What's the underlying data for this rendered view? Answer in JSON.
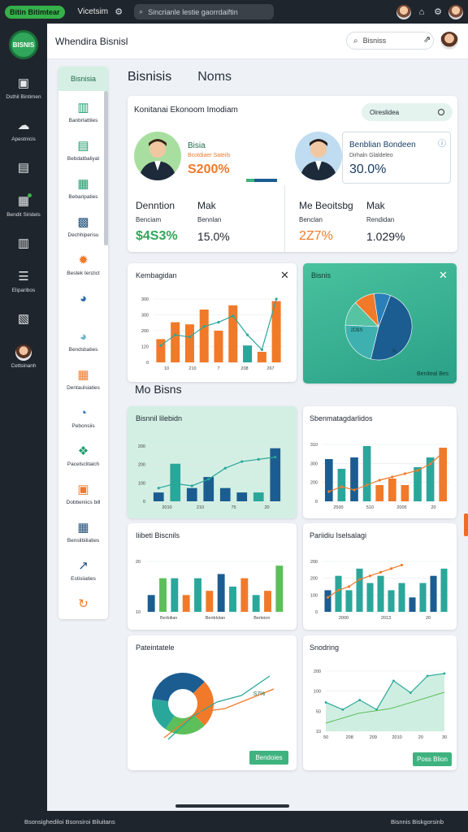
{
  "topbar": {
    "app_name": "Bitin Bitimtear",
    "label": "Vicetsim",
    "search_placeholder": "Sincrianle lestie gaorrdaiftin",
    "icons": [
      "search-icon",
      "home-icon",
      "gear-icon"
    ]
  },
  "sidebar": {
    "logo_text": "BISNIS",
    "items": [
      {
        "label": "Dsthil Bintimen",
        "icon": "dashboard-icon"
      },
      {
        "label": "Apestnicis",
        "icon": "cloud-icon"
      },
      {
        "label": "",
        "icon": "folder-icon"
      },
      {
        "label": "Bendit Siridels",
        "icon": "document-icon",
        "badge": true
      },
      {
        "label": "",
        "icon": "grid-icon"
      },
      {
        "label": "Eliparibos",
        "icon": "chat-icon"
      },
      {
        "label": "",
        "icon": "report-icon"
      },
      {
        "label": "Cettsinanh",
        "icon": "user-icon"
      }
    ]
  },
  "header": {
    "title": "Whendira Bisnisl",
    "search_label": "Bisniss"
  },
  "subnav": {
    "header": "Bisnisia",
    "items": [
      {
        "label": "Banbrlattiles",
        "icon": "chart-icon",
        "color": "#1e9b6e"
      },
      {
        "label": "Bebdatbaliyat",
        "icon": "monitor-icon",
        "color": "#1e9b6e"
      },
      {
        "label": "Bebaripaties",
        "icon": "table-icon",
        "color": "#1e9b6e"
      },
      {
        "label": "Dechhiperisu",
        "icon": "database-icon",
        "color": "#1f4f7a"
      },
      {
        "label": "Bestek tenzict",
        "icon": "gear-icon",
        "color": "#f07a2a"
      },
      {
        "label": "",
        "icon": "pie-icon",
        "color": "#2a6bb0"
      },
      {
        "label": "Bendsbaties",
        "icon": "pie-icon",
        "color": "#6fb0c9"
      },
      {
        "label": "Dentaulsiaties",
        "icon": "calendar-icon",
        "color": "#f07a2a"
      },
      {
        "label": "Pebonsiis",
        "icon": "donut-icon",
        "color": "#2a6bb0"
      },
      {
        "label": "Pacelsclitaich",
        "icon": "nodes-icon",
        "color": "#1e9b6e"
      },
      {
        "label": "Dobbeniics bill",
        "icon": "briefcase-icon",
        "color": "#f07a2a"
      },
      {
        "label": "Benslibiliaties",
        "icon": "calculator-icon",
        "color": "#1f4f7a"
      },
      {
        "label": "Estisiiaties",
        "icon": "trend-icon",
        "color": "#1f4f7a"
      },
      {
        "label": "",
        "icon": "refresh-icon",
        "color": "#f07a2a"
      }
    ]
  },
  "tabs": [
    "Bisnisis",
    "Noms"
  ],
  "kpi_card": {
    "title": "Konitanai Ekonoom Imodiam",
    "toggle_label": "Oireslidea",
    "left_person": {
      "name": "Bisia",
      "sub": "Bcotdiaer Sateils",
      "value": "S200%"
    },
    "right_person": {
      "name": "Benblian Bondeen",
      "sub": "Dirhaln Glaldeleo",
      "value": "30.0%"
    },
    "stats": [
      {
        "head": "Denntion",
        "lbl": "Benciam",
        "value": "$4S3%",
        "color": "#2fa65a"
      },
      {
        "head": "Mak",
        "lbl": "Bennlan",
        "value": "15.0%",
        "color": "#1d2530"
      },
      {
        "head": "Me Beoitsbg",
        "lbl": "Benclan",
        "value": "2Z7%",
        "color": "#f07a2a"
      },
      {
        "head": "Mak",
        "lbl": "Rendidan",
        "value": "1.029%",
        "color": "#1d2530"
      }
    ]
  },
  "chart_kembagidan": {
    "title": "Kembagidan",
    "xticks": [
      "10",
      "210",
      "7",
      "208",
      "267"
    ],
    "yticks": [
      "300",
      "300",
      "200",
      "120",
      "0"
    ]
  },
  "chart_bisnis_pie": {
    "title": "Bisnis",
    "label_a": "2D$S",
    "label_b": "%",
    "footer": "Beniteal Bes"
  },
  "section_title": "Mo Bisns",
  "chart_bisnil": {
    "title": "Bisnnil lilebidn",
    "yticks": [
      "200",
      "200",
      "100",
      "0"
    ],
    "xticks": [
      "2010",
      "210",
      "75",
      "20"
    ]
  },
  "chart_sbenmat": {
    "title": "Sbenmatagdarlidos",
    "yticks": [
      "310",
      "300",
      "200",
      "0"
    ],
    "xticks": [
      "2500",
      "510",
      "2005",
      "20"
    ]
  },
  "chart_iiibeti": {
    "title": "Iiibeti Biscnils",
    "yticks": [
      "20",
      "10"
    ],
    "xticks": [
      "Berbilian",
      "Benblolan",
      "Berleion"
    ]
  },
  "chart_pariidiu": {
    "title": "Pariidiu Iselsalagi",
    "yticks": [
      "200",
      "200",
      "100",
      "0"
    ],
    "xticks": [
      "2000",
      "2013",
      "20"
    ]
  },
  "chart_pateintate": {
    "title": "Pateintatele",
    "annotation": "S7%",
    "button": "Bendoies"
  },
  "chart_snodring": {
    "title": "Snodring",
    "yticks": [
      "200",
      "100",
      "50",
      "10"
    ],
    "xticks": [
      "50",
      "208",
      "209",
      "2010",
      "20",
      "30"
    ],
    "button": "Poss Blion"
  },
  "chart_data": [
    {
      "type": "bar",
      "title": "Kembagidan",
      "series": [
        {
          "name": "",
          "values": [
            110,
            190,
            180,
            250,
            150,
            270,
            80,
            50,
            290
          ]
        }
      ],
      "line": [
        80,
        130,
        120,
        170,
        190,
        220,
        130,
        60,
        300
      ]
    },
    {
      "type": "pie",
      "title": "Bisnis",
      "values": [
        48,
        22,
        12,
        10,
        8
      ]
    },
    {
      "type": "bar",
      "title": "Bisnnil lilebidn",
      "values": [
        40,
        170,
        60,
        110,
        60,
        40,
        40,
        240
      ],
      "line": [
        60,
        80,
        70,
        100,
        150,
        180,
        190,
        200
      ]
    },
    {
      "type": "bar",
      "title": "Sbenmatagdarlidos",
      "values": [
        260,
        200,
        270,
        340,
        100,
        140,
        100,
        210,
        270,
        330
      ]
    },
    {
      "type": "bar",
      "title": "Iiibeti Biscnils",
      "values": [
        20,
        40,
        40,
        20,
        40,
        25,
        45,
        30,
        40,
        20,
        25,
        55
      ]
    },
    {
      "type": "bar",
      "title": "Pariidiu Iselsalagi",
      "values": [
        30,
        50,
        30,
        60,
        40,
        50,
        30,
        40,
        20,
        40,
        50,
        60
      ]
    },
    {
      "type": "pie",
      "title": "Pateintatele",
      "values": [
        35,
        25,
        22,
        18
      ]
    },
    {
      "type": "area",
      "title": "Snodring",
      "values": [
        120,
        90,
        130,
        90,
        210,
        160,
        230,
        240
      ]
    }
  ],
  "colors": {
    "teal": "#2aa79b",
    "orange": "#f07a2a",
    "navy": "#1b5d91",
    "green": "#5cbf5a",
    "mint": "#cfeee2"
  },
  "footer": {
    "left": "Bsonsighediloi Bsonsiroi Biluitans",
    "right": "Bisnnis Biskgorsinb"
  }
}
